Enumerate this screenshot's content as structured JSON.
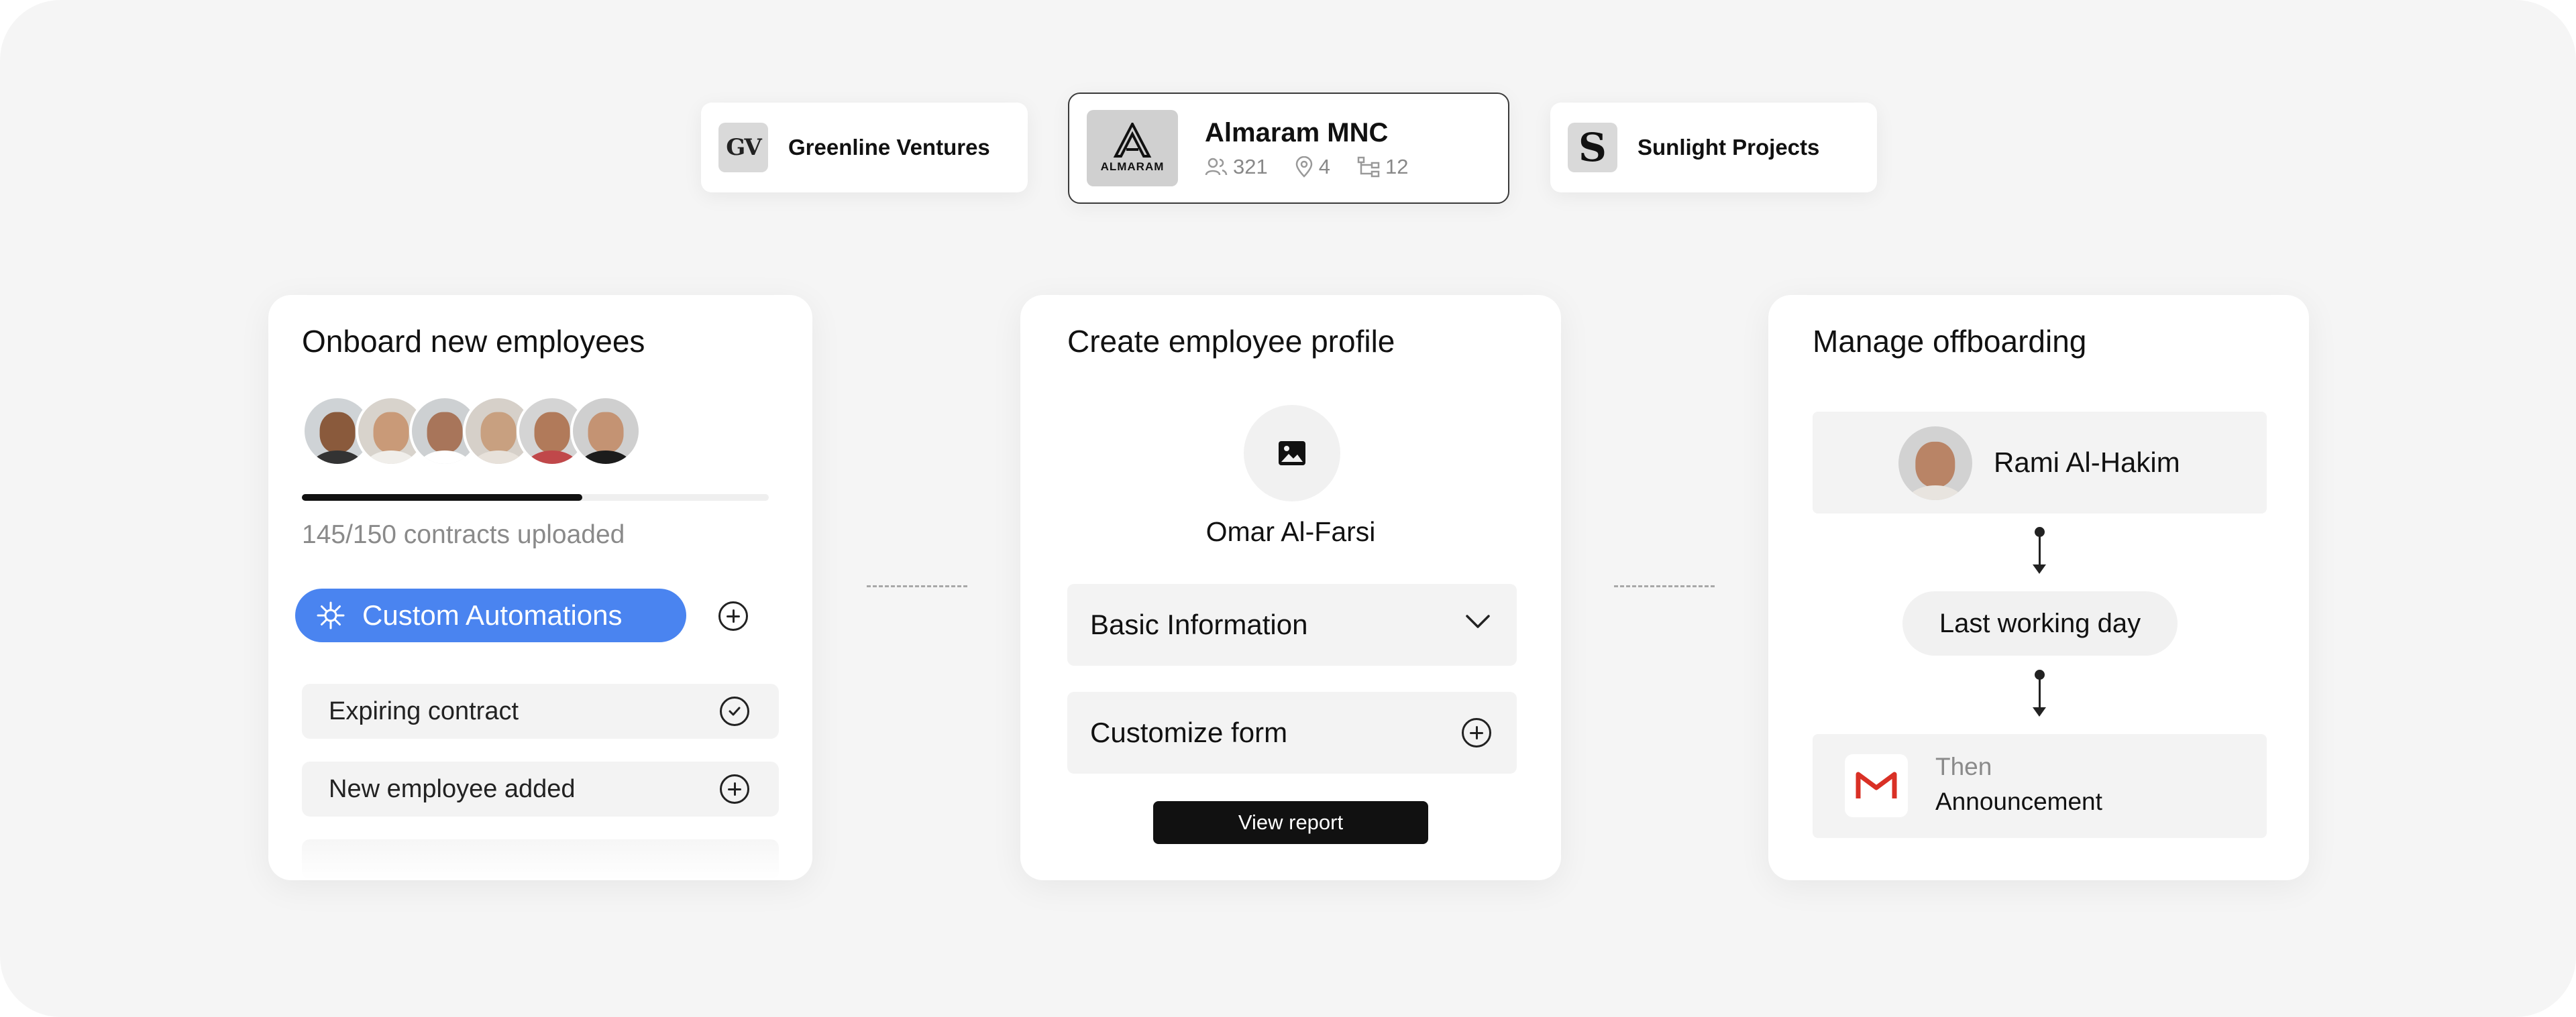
{
  "colors": {
    "accent": "#4a84f0",
    "background": "#f5f5f5",
    "card": "#ffffff",
    "gmail_red": "#d93025"
  },
  "companies": [
    {
      "name": "Greenline Ventures",
      "logo": "GV",
      "icon": "gv-logo-icon"
    },
    {
      "name": "Almaram MNC",
      "logo": "ALMARAM",
      "icon": "almaram-logo-icon",
      "stats": {
        "people": "321",
        "locations": "4",
        "departments": "12"
      }
    },
    {
      "name": "Sunlight Projects",
      "logo": "S",
      "icon": "sunlight-logo-icon"
    }
  ],
  "onboard": {
    "title": "Onboard new employees",
    "progress": {
      "fraction": 0.6,
      "label": "145/150 contracts uploaded"
    },
    "automation_label": "Custom Automations",
    "triggers": [
      {
        "label": "Expiring contract",
        "icon": "check-circle-icon"
      },
      {
        "label": "New employee added",
        "icon": "plus-circle-icon"
      }
    ]
  },
  "profile": {
    "title": "Create employee profile",
    "name": "Omar Al-Farsi",
    "sections": [
      {
        "label": "Basic Information",
        "icon": "chevron-down-icon"
      },
      {
        "label": "Customize form",
        "icon": "plus-circle-icon"
      }
    ],
    "view_report": "View report"
  },
  "offboarding": {
    "title": "Manage offboarding",
    "employee": "Rami Al-Hakim",
    "trigger": "Last working day",
    "then": "Then",
    "action": "Announcement",
    "action_icon": "gmail-icon"
  }
}
